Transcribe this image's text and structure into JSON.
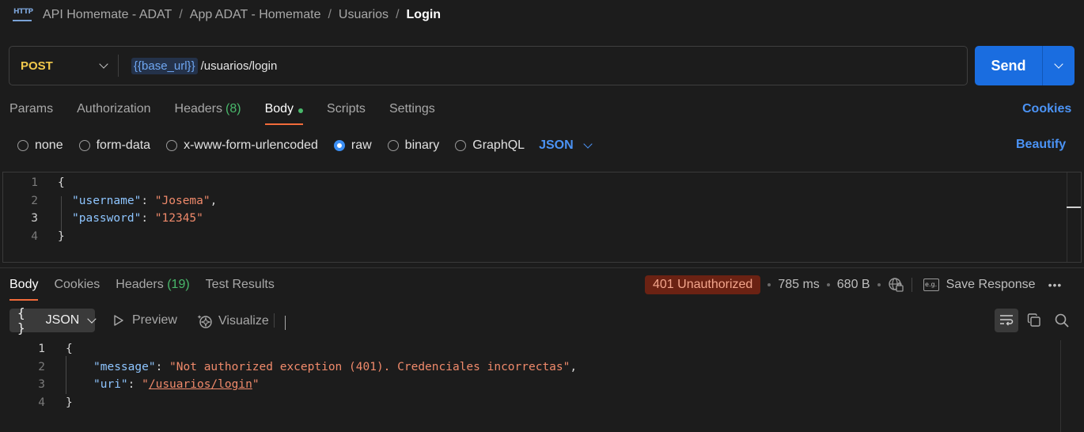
{
  "breadcrumb": {
    "icon": "http-icon",
    "items": [
      "API Homemate - ADAT",
      "App ADAT - Homemate",
      "Usuarios"
    ],
    "current": "Login",
    "separator": "/"
  },
  "request": {
    "method": "POST",
    "url_variable": "{{base_url}}",
    "url_path": "/usuarios/login",
    "send_label": "Send"
  },
  "request_tabs": {
    "params": "Params",
    "authorization": "Authorization",
    "headers": "Headers",
    "headers_count": "(8)",
    "body": "Body",
    "scripts": "Scripts",
    "settings": "Settings",
    "cookies": "Cookies"
  },
  "body_types": {
    "none": "none",
    "form_data": "form-data",
    "urlencoded": "x-www-form-urlencoded",
    "raw": "raw",
    "binary": "binary",
    "graphql": "GraphQL",
    "format": "JSON",
    "beautify": "Beautify"
  },
  "request_body": {
    "line_numbers": [
      "1",
      "2",
      "3",
      "4"
    ],
    "open_brace": "{",
    "close_brace": "}",
    "username_key": "\"username\"",
    "username_value": "\"Josema\"",
    "password_key": "\"password\"",
    "password_value": "\"12345\""
  },
  "response_tabs": {
    "body": "Body",
    "cookies": "Cookies",
    "headers": "Headers",
    "headers_count": "(19)",
    "test_results": "Test Results"
  },
  "response_meta": {
    "status": "401 Unauthorized",
    "time": "785 ms",
    "size": "680 B",
    "save_response": "Save Response",
    "eg_label": "e.g.",
    "more": "•••"
  },
  "response_toolbar": {
    "format_braces": "{ }",
    "format": "JSON",
    "preview": "Preview",
    "visualize": "Visualize"
  },
  "response_body": {
    "line_numbers": [
      "1",
      "2",
      "3",
      "4"
    ],
    "open_brace": "{",
    "close_brace": "}",
    "message_key": "\"message\"",
    "message_value": "\"Not authorized exception (401). Credenciales incorrectas\"",
    "uri_key": "\"uri\"",
    "uri_value": "/usuarios/login"
  },
  "colors": {
    "accent_blue": "#1a6de0",
    "link_blue": "#4b93f5",
    "method_yellow": "#f2c94c",
    "count_green": "#49b86b",
    "tab_underline": "#f26b3a",
    "status_bg": "#6b2213"
  }
}
